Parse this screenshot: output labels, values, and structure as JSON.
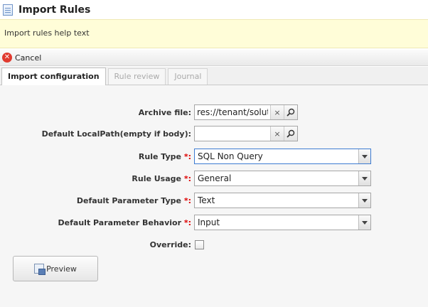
{
  "window": {
    "title": "Import Rules"
  },
  "help": {
    "text": "Import rules help text"
  },
  "toolbar": {
    "cancel_label": "Cancel"
  },
  "tabs": [
    {
      "label": "Import configuration",
      "active": true
    },
    {
      "label": "Rule review",
      "active": false
    },
    {
      "label": "Journal",
      "active": false
    }
  ],
  "form": {
    "archive_file": {
      "label": "Archive file:",
      "value": "res://tenant/soluti"
    },
    "default_localpath": {
      "label": "Default LocalPath(empty if body):",
      "value": ""
    },
    "rule_type": {
      "label": "Rule Type",
      "required": "*:",
      "value": "SQL Non Query"
    },
    "rule_usage": {
      "label": "Rule Usage",
      "required": "*:",
      "value": "General"
    },
    "default_parameter_type": {
      "label": "Default Parameter Type",
      "required": "*:",
      "value": "Text"
    },
    "default_parameter_behavior": {
      "label": "Default Parameter Behavior",
      "required": "*:",
      "value": "Input"
    },
    "override": {
      "label": "Override:",
      "checked": false
    }
  },
  "preview_button": {
    "label": "Preview"
  },
  "icons": {
    "clear": "×",
    "search": "magnifier-icon"
  },
  "colors": {
    "help_background": "#fffdd8",
    "required": "#dd0000",
    "focus_border": "#3d7bd1"
  }
}
